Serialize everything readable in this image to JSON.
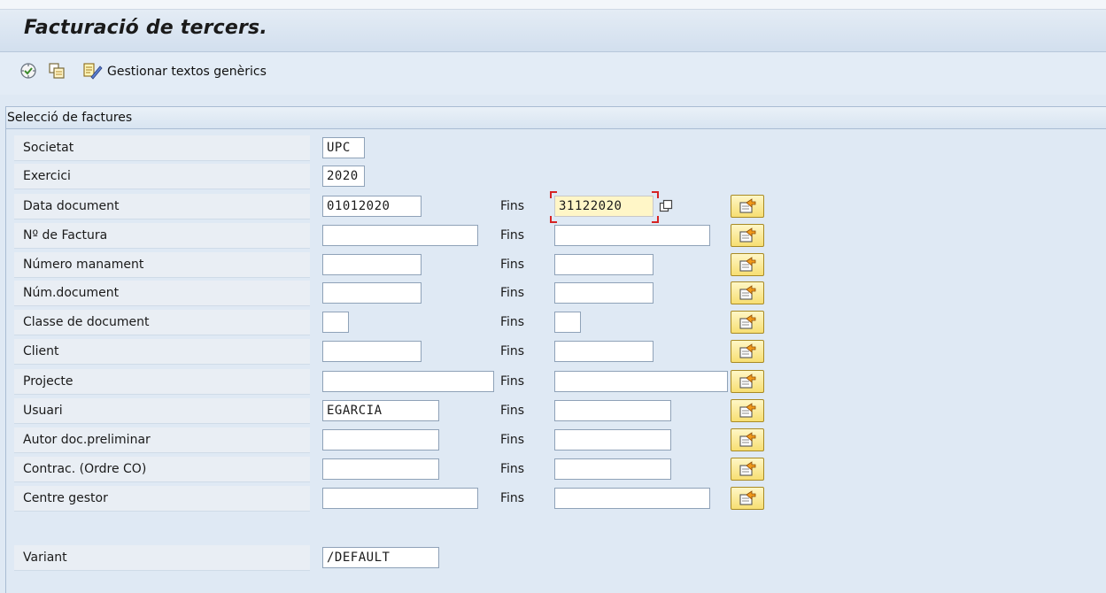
{
  "title": "Facturació de tercers.",
  "toolbar": {
    "execute_icon": "execute-icon",
    "get_variant_icon": "get-variant-icon",
    "texts_icon": "edit-texts-icon",
    "texts_label": "Gestionar textos genèrics"
  },
  "section": {
    "title": "Selecció de factures",
    "fins_label": "Fins",
    "rows": [
      {
        "label": "Societat",
        "value": "UPC",
        "has_to": false
      },
      {
        "label": "Exercici",
        "value": "2020",
        "has_to": false
      },
      {
        "label": "Data document",
        "value": "01012020",
        "to_value": "31122020",
        "has_to": true
      },
      {
        "label": "Nº de Factura",
        "value": "",
        "to_value": "",
        "has_to": true
      },
      {
        "label": "Número manament",
        "value": "",
        "to_value": "",
        "has_to": true
      },
      {
        "label": "Núm.document",
        "value": "",
        "to_value": "",
        "has_to": true
      },
      {
        "label": "Classe de document",
        "value": "",
        "to_value": "",
        "has_to": true
      },
      {
        "label": "Client",
        "value": "",
        "to_value": "",
        "has_to": true
      },
      {
        "label": "Projecte",
        "value": "",
        "to_value": "",
        "has_to": true
      },
      {
        "label": "Usuari",
        "value": "EGARCIA",
        "to_value": "",
        "has_to": true
      },
      {
        "label": "Autor doc.preliminar",
        "value": "",
        "to_value": "",
        "has_to": true
      },
      {
        "label": "Contrac. (Ordre CO)",
        "value": "",
        "to_value": "",
        "has_to": true
      },
      {
        "label": "Centre gestor",
        "value": "",
        "to_value": "",
        "has_to": true
      }
    ],
    "variant": {
      "label": "Variant",
      "value": "/DEFAULT"
    }
  },
  "colors": {
    "background": "#dfe9f4",
    "focused_field": "#fff6c7",
    "multisel_button": "#f7df72"
  }
}
